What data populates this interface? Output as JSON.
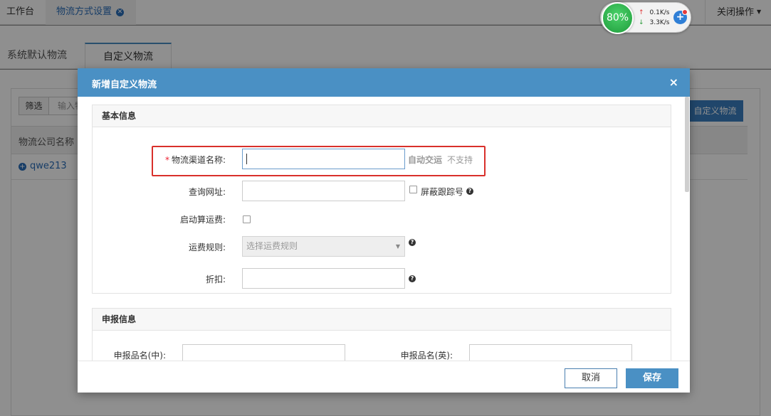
{
  "top_tabs": {
    "workbench": "工作台",
    "logistics_settings": "物流方式设置",
    "close_ops": "关闭操作"
  },
  "sub_tabs": {
    "system_default": "系统默认物流",
    "custom": "自定义物流"
  },
  "main": {
    "filter_button": "筛选",
    "filter_input_text": "输入物",
    "add_custom_button": "自定义物流",
    "table_header_name": "物流公司名称",
    "rows": [
      {
        "name": "qwe213"
      }
    ]
  },
  "net_widget": {
    "percent": "80%",
    "upload": "0.1K/s",
    "download": "3.3K/s"
  },
  "modal": {
    "title": "新增自定义物流",
    "close": "×",
    "basic_section": {
      "title": "基本信息",
      "channel_name_label": "物流渠道名称:",
      "channel_name_value": "",
      "auto_submit_label": "自动交运",
      "auto_submit_status": "不支持",
      "query_url_label": "查询网址:",
      "hide_tracking_label": "屏蔽跟踪号",
      "start_freight_label": "启动算运费:",
      "freight_rule_label": "运费规则:",
      "freight_rule_placeholder": "选择运费规则",
      "discount_label": "折扣:"
    },
    "declare_section": {
      "title": "申报信息",
      "name_cn_label": "申报品名(中):",
      "name_en_label": "申报品名(英):"
    },
    "footer": {
      "cancel": "取消",
      "save": "保存"
    }
  },
  "colors": {
    "header_blue": "#4a90c4",
    "link_blue": "#2a6db8",
    "highlight_red": "#d9302b",
    "required_red": "#e23"
  }
}
